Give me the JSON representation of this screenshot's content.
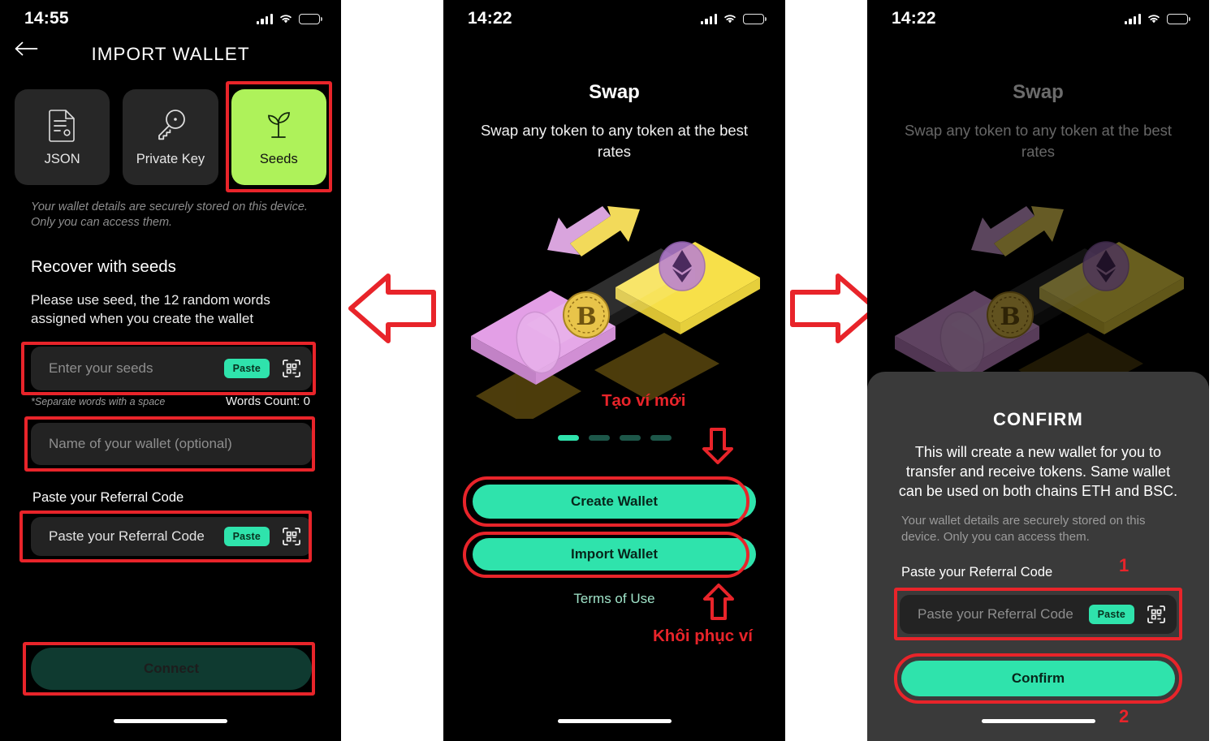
{
  "meta": {
    "accent_green": "#2fe3ac",
    "seed_green": "#aef25a",
    "highlight_red": "#e8242a",
    "sheet_bg": "#3a3a3a"
  },
  "panel1": {
    "status": {
      "time": "14:55",
      "battery_icon": "battery-icon",
      "wifi_icon": "wifi-icon",
      "signal_icon": "signal-icon"
    },
    "back_icon": "back-arrow-icon",
    "title": "IMPORT WALLET",
    "methods": [
      {
        "label": "JSON",
        "icon": "document-icon",
        "active": false
      },
      {
        "label": "Private Key",
        "icon": "key-icon",
        "active": false
      },
      {
        "label": "Seeds",
        "icon": "seedling-icon",
        "active": true
      }
    ],
    "security_note": "Your wallet details are securely stored on this device. Only you can access them.",
    "section_title": "Recover with seeds",
    "section_desc": "Please use seed, the 12 random words assigned when you create the wallet",
    "seed_input": {
      "placeholder": "Enter your seeds",
      "paste_label": "Paste",
      "scan_icon": "qr-scan-icon"
    },
    "hint_left": "*Separate words with a space",
    "hint_right": "Words Count: 0",
    "wallet_name_input": {
      "placeholder": "Name of your wallet (optional)"
    },
    "referral_label": "Paste your Referral Code",
    "referral_input": {
      "value": "Paste your Referral Code",
      "paste_label": "Paste",
      "scan_icon": "qr-scan-icon"
    },
    "connect_button": "Connect"
  },
  "panel2": {
    "status": {
      "time": "14:22",
      "battery_icon": "battery-icon",
      "wifi_icon": "wifi-icon",
      "signal_icon": "signal-icon"
    },
    "title": "Swap",
    "subtitle": "Swap any token to any token at the best rates",
    "illustration": "token-swap-illustration",
    "pagination": {
      "count": 4,
      "active_index": 0
    },
    "create_button": "Create Wallet",
    "import_button": "Import Wallet",
    "terms_link": "Terms of Use",
    "annotations": {
      "create_note": "Tạo ví mới",
      "import_note": "Khôi phục ví"
    }
  },
  "panel3": {
    "status": {
      "time": "14:22",
      "battery_icon": "battery-icon",
      "wifi_icon": "wifi-icon",
      "signal_icon": "signal-icon"
    },
    "title": "Swap",
    "subtitle": "Swap any token to any token at the best rates",
    "illustration": "token-swap-illustration",
    "sheet": {
      "title": "CONFIRM",
      "description": "This will create a new wallet for you to transfer and receive tokens. Same wallet can be used on both chains ETH and BSC.",
      "note": "Your wallet details are securely stored on this device. Only you can access them.",
      "referral_label": "Paste your Referral Code",
      "referral_input": {
        "value": "Paste your Referral Code",
        "paste_label": "Paste",
        "scan_icon": "qr-scan-icon"
      },
      "confirm_button": "Confirm"
    },
    "annotations": {
      "step_one": "1",
      "step_two": "2"
    }
  },
  "flow": {
    "arrow_left": "arrow-left-icon",
    "arrow_right": "arrow-right-icon"
  }
}
